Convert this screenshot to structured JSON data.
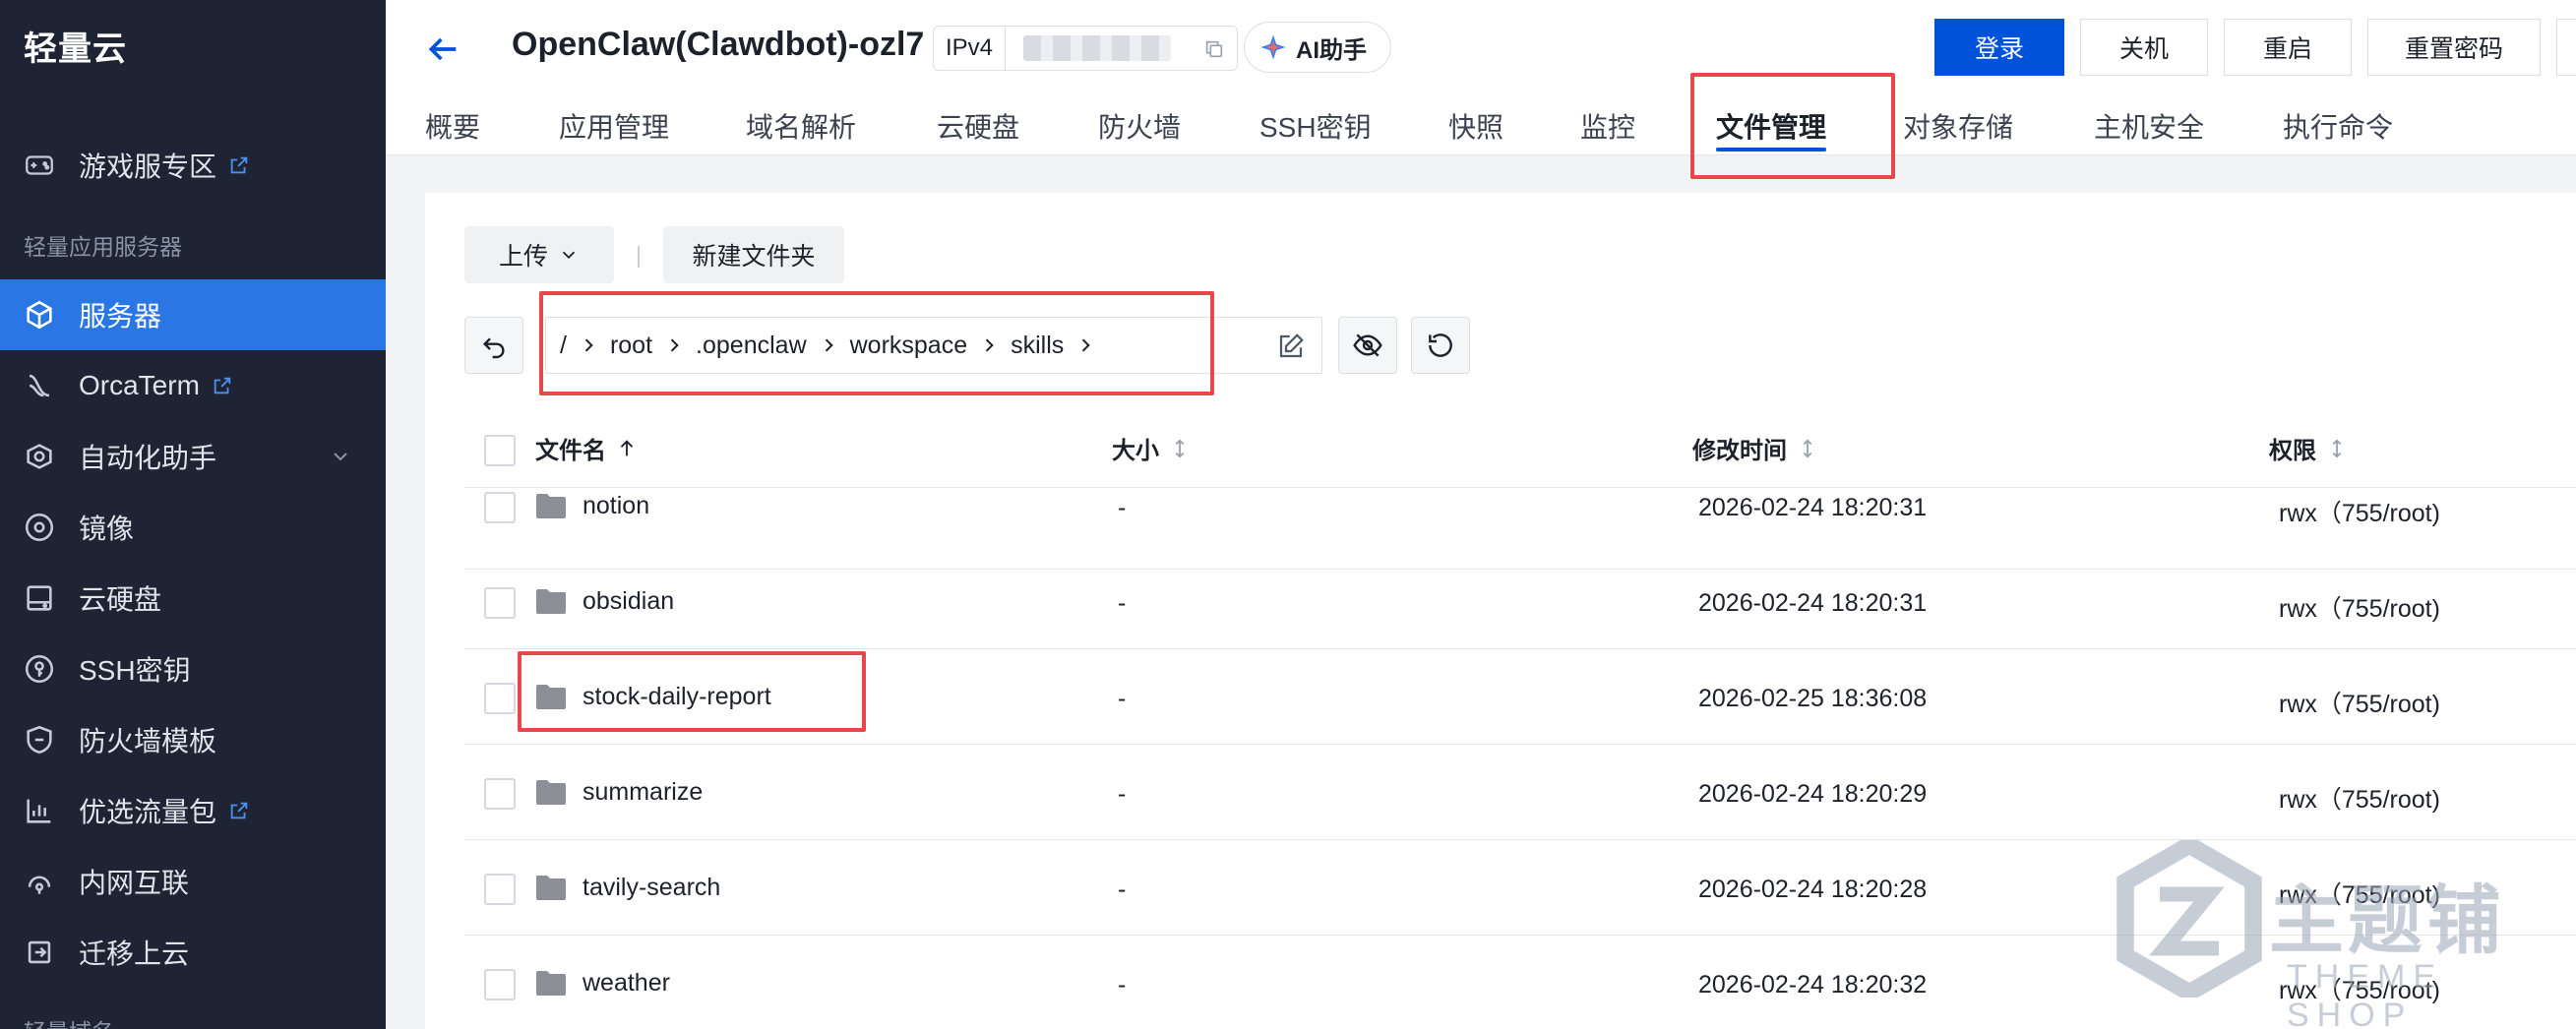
{
  "sidebar": {
    "brand": "轻量云",
    "items_top": [
      {
        "label": "游戏服专区",
        "icon": "gamepad-icon",
        "external": true
      }
    ],
    "section_label": "轻量应用服务器",
    "items": [
      {
        "label": "服务器",
        "icon": "cube-icon",
        "active": true
      },
      {
        "label": "OrcaTerm",
        "icon": "terminal-icon",
        "external": true
      },
      {
        "label": "自动化助手",
        "icon": "automation-icon",
        "expandable": true
      },
      {
        "label": "镜像",
        "icon": "disc-icon"
      },
      {
        "label": "云硬盘",
        "icon": "disk-icon"
      },
      {
        "label": "SSH密钥",
        "icon": "key-icon"
      },
      {
        "label": "防火墙模板",
        "icon": "shield-icon"
      },
      {
        "label": "优选流量包",
        "icon": "chart-icon",
        "external": true
      },
      {
        "label": "内网互联",
        "icon": "link-icon"
      },
      {
        "label": "迁移上云",
        "icon": "migrate-icon"
      }
    ],
    "bottom_section_label": "轻量域名"
  },
  "header": {
    "title": "OpenClaw(Clawdbot)-ozl7",
    "ip_label": "IPv4",
    "ai_label": "AI助手",
    "buttons": {
      "login": "登录",
      "shutdown": "关机",
      "restart": "重启",
      "reset_password": "重置密码"
    }
  },
  "tabs": [
    "概要",
    "应用管理",
    "域名解析",
    "云硬盘",
    "防火墙",
    "SSH密钥",
    "快照",
    "监控",
    "文件管理",
    "对象存储",
    "主机安全",
    "执行命令"
  ],
  "active_tab": "文件管理",
  "toolbar": {
    "upload": "上传",
    "new_folder": "新建文件夹"
  },
  "path": {
    "root": "/",
    "segments": [
      "root",
      ".openclaw",
      "workspace",
      "skills"
    ]
  },
  "table": {
    "columns": {
      "name": "文件名",
      "size": "大小",
      "modified": "修改时间",
      "perm": "权限"
    },
    "rows": [
      {
        "name": "notion",
        "size": "-",
        "modified": "2026-02-24 18:20:31",
        "perm": "rwx（755/root)"
      },
      {
        "name": "obsidian",
        "size": "-",
        "modified": "2026-02-24 18:20:31",
        "perm": "rwx（755/root)"
      },
      {
        "name": "stock-daily-report",
        "size": "-",
        "modified": "2026-02-25 18:36:08",
        "perm": "rwx（755/root)"
      },
      {
        "name": "summarize",
        "size": "-",
        "modified": "2026-02-24 18:20:29",
        "perm": "rwx（755/root)"
      },
      {
        "name": "tavily-search",
        "size": "-",
        "modified": "2026-02-24 18:20:28",
        "perm": "rwx（755/root)"
      },
      {
        "name": "weather",
        "size": "-",
        "modified": "2026-02-24 18:20:32",
        "perm": "rwx（755/root)"
      }
    ]
  },
  "watermark": {
    "main": "主题铺",
    "sub": "THEME SHOP"
  },
  "colors": {
    "sidebar_bg": "#1e2433",
    "active_blue": "#2b76e5",
    "primary": "#0052d9",
    "highlight_red": "#e8474b"
  }
}
